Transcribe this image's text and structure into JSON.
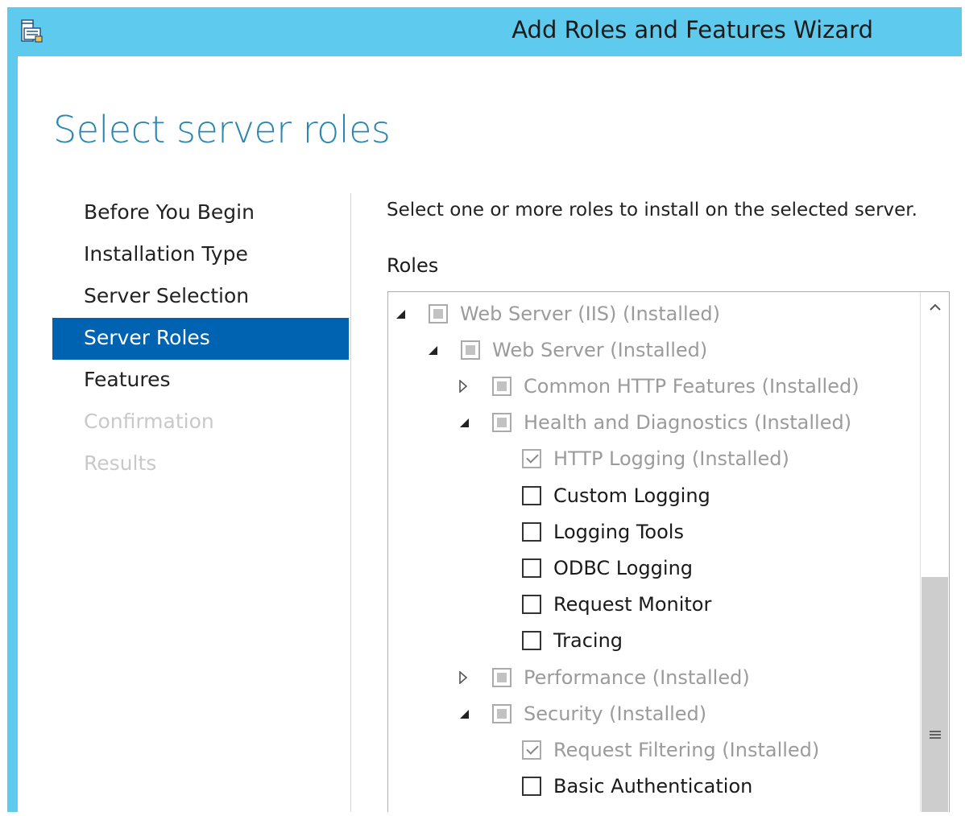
{
  "window": {
    "title": "Add Roles and Features Wizard",
    "app_icon": "server-manager-wizard-icon"
  },
  "page": {
    "title": "Select server roles",
    "instruction": "Select one or more roles to install on the selected server.",
    "roles_heading": "Roles"
  },
  "nav": {
    "items": [
      {
        "label": "Before You Begin",
        "state": "normal"
      },
      {
        "label": "Installation Type",
        "state": "normal"
      },
      {
        "label": "Server Selection",
        "state": "normal"
      },
      {
        "label": "Server Roles",
        "state": "selected"
      },
      {
        "label": "Features",
        "state": "normal"
      },
      {
        "label": "Confirmation",
        "state": "disabled"
      },
      {
        "label": "Results",
        "state": "disabled"
      }
    ]
  },
  "roles_tree": [
    {
      "label": "Web Server (IIS) (Installed)",
      "level": 0,
      "expander": "expanded",
      "check": "partial",
      "greyed": true
    },
    {
      "label": "Web Server (Installed)",
      "level": 1,
      "expander": "expanded",
      "check": "partial",
      "greyed": true
    },
    {
      "label": "Common HTTP Features (Installed)",
      "level": 2,
      "expander": "collapsed",
      "check": "partial",
      "greyed": true
    },
    {
      "label": "Health and Diagnostics (Installed)",
      "level": 2,
      "expander": "expanded",
      "check": "partial",
      "greyed": true
    },
    {
      "label": "HTTP Logging (Installed)",
      "level": 3,
      "expander": "none",
      "check": "checked",
      "greyed": true
    },
    {
      "label": "Custom Logging",
      "level": 3,
      "expander": "none",
      "check": "unchecked",
      "greyed": false
    },
    {
      "label": "Logging Tools",
      "level": 3,
      "expander": "none",
      "check": "unchecked",
      "greyed": false
    },
    {
      "label": "ODBC Logging",
      "level": 3,
      "expander": "none",
      "check": "unchecked",
      "greyed": false
    },
    {
      "label": "Request Monitor",
      "level": 3,
      "expander": "none",
      "check": "unchecked",
      "greyed": false
    },
    {
      "label": "Tracing",
      "level": 3,
      "expander": "none",
      "check": "unchecked",
      "greyed": false
    },
    {
      "label": "Performance (Installed)",
      "level": 2,
      "expander": "collapsed",
      "check": "partial",
      "greyed": true
    },
    {
      "label": "Security (Installed)",
      "level": 2,
      "expander": "expanded",
      "check": "partial",
      "greyed": true
    },
    {
      "label": "Request Filtering (Installed)",
      "level": 3,
      "expander": "none",
      "check": "checked",
      "greyed": true
    },
    {
      "label": "Basic Authentication",
      "level": 3,
      "expander": "none",
      "check": "unchecked",
      "greyed": false
    }
  ],
  "icons": {
    "scroll_up": "chevron-up-icon",
    "scroll_grip": "grip-icon",
    "expanded": "triangle-expanded-icon",
    "collapsed": "triangle-collapsed-icon"
  },
  "colors": {
    "title_bar": "#5ecbee",
    "accent": "#0063b1",
    "page_title": "#2b86b2",
    "disabled_text": "#c9c9c9",
    "greyed_text": "#9b9b9b"
  }
}
